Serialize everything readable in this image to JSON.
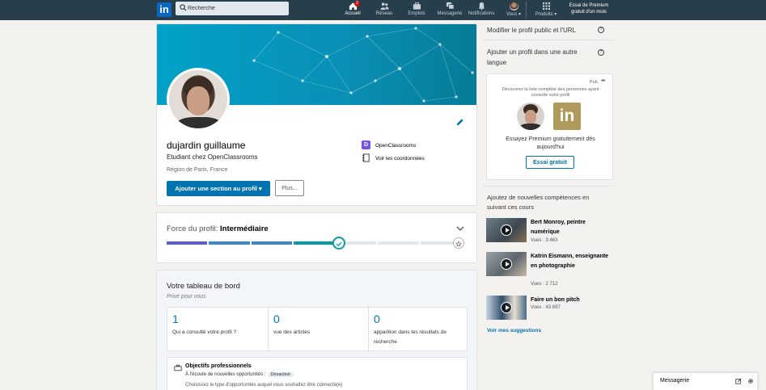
{
  "nav": {
    "logo": "in",
    "search_placeholder": "Recherche",
    "items": [
      {
        "label": "Accueil",
        "icon": "home-icon",
        "badge": "2"
      },
      {
        "label": "Réseau",
        "icon": "network-icon"
      },
      {
        "label": "Emplois",
        "icon": "briefcase-icon"
      },
      {
        "label": "Messagerie",
        "icon": "messaging-icon"
      },
      {
        "label": "Notifications",
        "icon": "bell-icon"
      },
      {
        "label": "Vous",
        "icon": "avatar"
      },
      {
        "label": "Produits",
        "icon": "grid-icon"
      }
    ],
    "premium": "Essai de Premium gratuit d'un mois"
  },
  "profile": {
    "name": "dujardin guillaume",
    "headline": "Etudiant chez OpenClassrooms",
    "location": "Région de Paris, France",
    "add_section_label": "Ajouter une section au profil",
    "more_label": "Plus...",
    "company": "OpenClassrooms",
    "contact_label": "Voir les coordonnées",
    "company_logo_letter": "D"
  },
  "strength": {
    "label": "Force du profil:",
    "level": "Intermédiaire",
    "filled_segments": 4,
    "total_segments": 7,
    "colors": {
      "start": "#5a5ed4",
      "mid": "#3b89c9",
      "end": "#0a9aa6",
      "empty": "#e1e9ee"
    }
  },
  "dashboard": {
    "title": "Votre tableau de bord",
    "subtitle": "Privé pour vous",
    "stats": [
      {
        "num": "1",
        "label": "Qui a consulté votre profil ?"
      },
      {
        "num": "0",
        "label": "vue des articles"
      },
      {
        "num": "0",
        "label": "apparition dans les résultats de recherche"
      }
    ],
    "goals_title": "Objectifs professionnels",
    "goals_status_text": "À l'écoute de nouvelles opportunités :",
    "goals_status_tag": "Désactivé",
    "goals_hint": "Choisissez le type d'opportunités auquel vous souhaitez être connecté(e)"
  },
  "right": {
    "edit_public": "Modifier le profil public et l'URL",
    "add_language": "Ajouter un profil dans une autre langue",
    "ad": {
      "pub": "Pub",
      "text": "Découvrez la liste complète des personnes ayant consulté votre profil",
      "logo": "in",
      "cta_text": "Essayez Premium gratuitement dès aujourd'hui",
      "button": "Essai gratuit"
    },
    "courses_title": "Ajoutez de nouvelles compétences en suivant ces cours",
    "courses": [
      {
        "title": "Bert Monroy, peintre numérique",
        "views": "Vues : 3 463"
      },
      {
        "title": "Katrin Eismann, enseignante en photographie",
        "views": "Vues : 2 712"
      },
      {
        "title": "Faire un bon pitch",
        "views": "Vues : 43 697"
      }
    ],
    "see_more": "Voir mes suggestions"
  },
  "messaging": {
    "label": "Messagerie"
  },
  "colors": {
    "nav": "#283e4a",
    "brand": "#0073b1",
    "accent": "#0a9aa6"
  }
}
